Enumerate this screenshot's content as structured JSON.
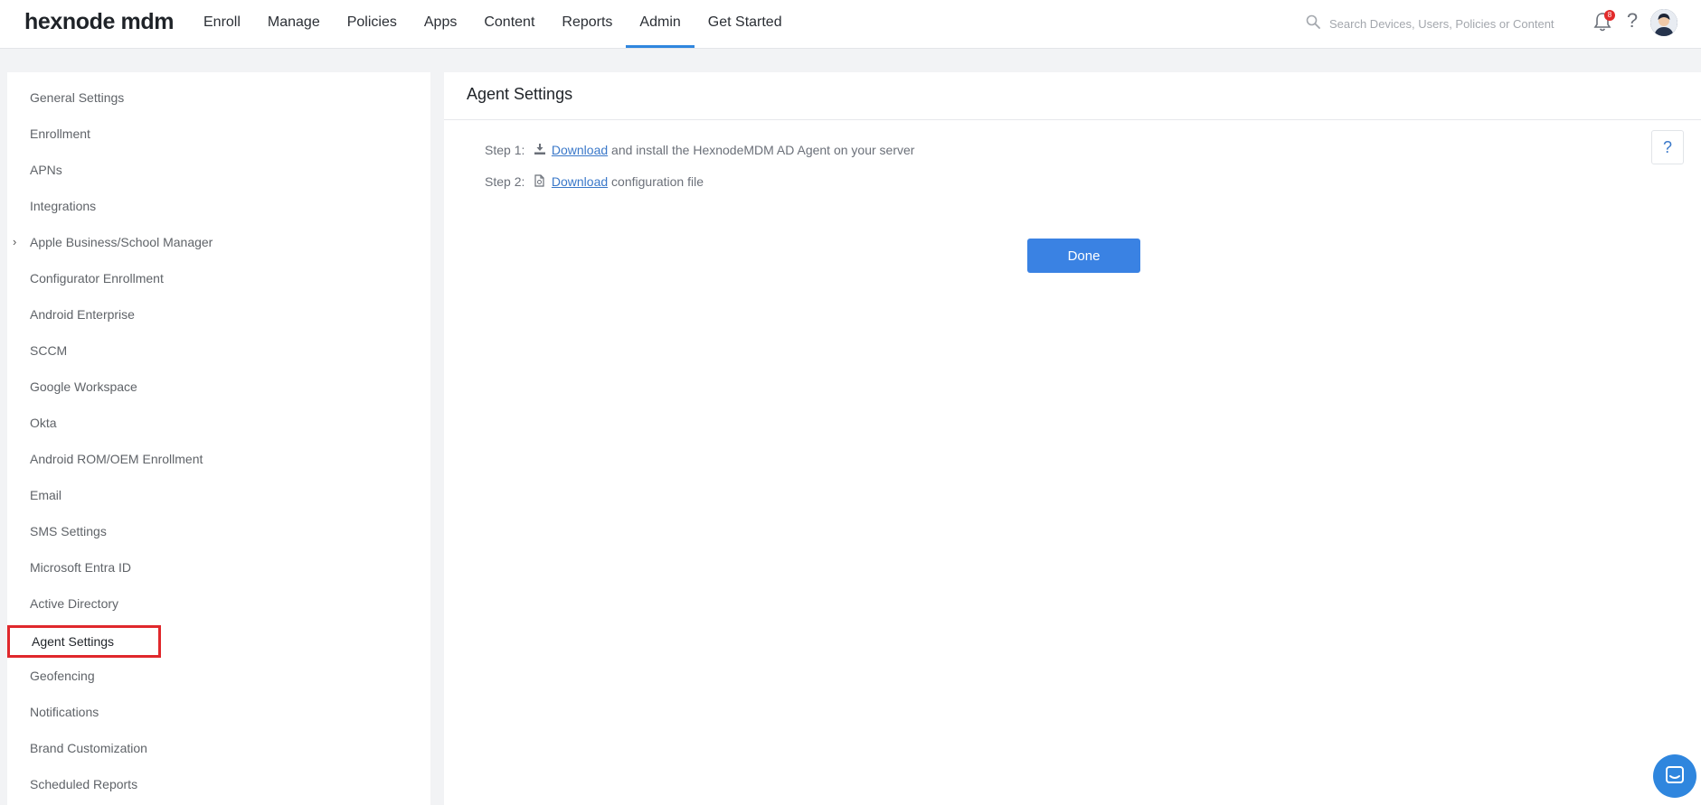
{
  "header": {
    "logo": "hexnode mdm",
    "nav": [
      "Enroll",
      "Manage",
      "Policies",
      "Apps",
      "Content",
      "Reports",
      "Admin",
      "Get Started"
    ],
    "active_nav": "Admin",
    "search_placeholder": "Search Devices, Users, Policies or Content",
    "notification_count": "8",
    "help_label": "?"
  },
  "sidebar": {
    "items": [
      "General Settings",
      "Enrollment",
      "APNs",
      "Integrations",
      "Apple Business/School Manager",
      "Configurator Enrollment",
      "Android Enterprise",
      "SCCM",
      "Google Workspace",
      "Okta",
      "Android ROM/OEM Enrollment",
      "Email",
      "SMS Settings",
      "Microsoft Entra ID",
      "Active Directory",
      "Agent Settings",
      "Geofencing",
      "Notifications",
      "Brand Customization",
      "Scheduled Reports"
    ],
    "selected": "Agent Settings",
    "expandable_item": "Apple Business/School Manager"
  },
  "main": {
    "title": "Agent Settings",
    "help_label": "?",
    "steps": [
      {
        "label": "Step 1:",
        "link": "Download",
        "text": " and install the HexnodeMDM AD Agent on your server",
        "icon": "download-icon"
      },
      {
        "label": "Step 2:",
        "link": "Download",
        "text": " configuration file",
        "icon": "file-icon"
      }
    ],
    "done_label": "Done"
  },
  "colors": {
    "accent": "#2f86de",
    "button": "#3a82e3",
    "link": "#3a78c9",
    "highlight": "#e0282c",
    "badge": "#e22b2b"
  }
}
